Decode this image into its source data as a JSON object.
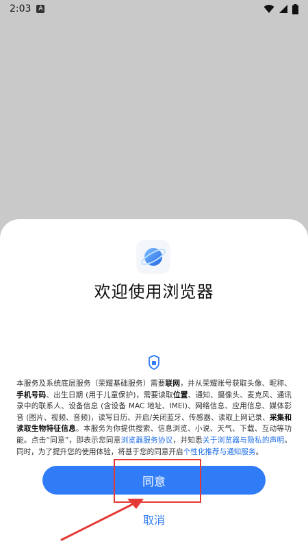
{
  "status_bar": {
    "time": "2:03",
    "notification_letter": "A",
    "icons": [
      "wifi-icon",
      "signal-icon",
      "battery-icon"
    ]
  },
  "dialog": {
    "title": "欢迎使用浏览器",
    "body": [
      {
        "text": "本服务及系统底层服务（荣耀基础服务）需要",
        "style": "normal"
      },
      {
        "text": "联网",
        "style": "strong"
      },
      {
        "text": "，并从荣耀账号获取头像、昵称、",
        "style": "normal"
      },
      {
        "text": "手机号码",
        "style": "strong"
      },
      {
        "text": "、出生日期 (用于儿童保护)，需要读取",
        "style": "normal"
      },
      {
        "text": "位置",
        "style": "strong"
      },
      {
        "text": "、通知、摄像头、麦克风、通讯录中的联系人、设备信息 (含设备 MAC 地址、IMEI)、网络信息、应用信息、媒体影音 (图片、视频、音频)，读写日历、开启/关闭蓝牙、传感器、读取上网记录、",
        "style": "normal"
      },
      {
        "text": "采集和读取生物特征信息",
        "style": "strong"
      },
      {
        "text": "。本服务为你提供搜索、信息浏览、小说、天气、下载、互动等功能。点击“同意”，即表示您同意",
        "style": "normal"
      },
      {
        "text": "浏览器服务协议",
        "style": "link"
      },
      {
        "text": "，并知悉",
        "style": "normal"
      },
      {
        "text": "关于浏览器与隐私的声明",
        "style": "link"
      },
      {
        "text": "。同时，为了提升您的使用体验，将基于您的同意开启",
        "style": "normal"
      },
      {
        "text": "个性化推荐与通知服务",
        "style": "link"
      },
      {
        "text": "。",
        "style": "normal"
      }
    ],
    "agree_label": "同意",
    "cancel_label": "取消"
  },
  "colors": {
    "accent": "#2f7cf6",
    "link": "#1f6fe8",
    "annotation": "#e53935",
    "backdrop": "#c9c9c9"
  }
}
